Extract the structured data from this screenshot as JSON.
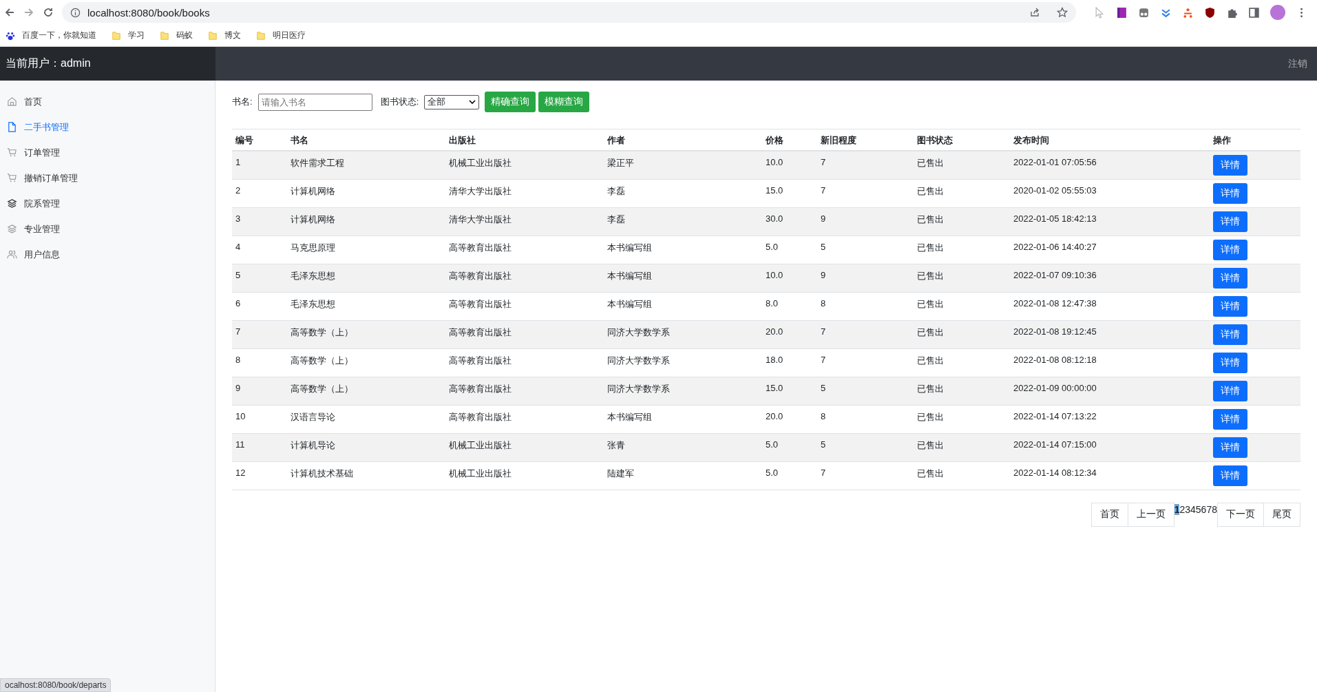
{
  "browser": {
    "url": "localhost:8080/book/books",
    "bookmarks": [
      {
        "label": "百度一下，你就知道",
        "kind": "site"
      },
      {
        "label": "学习",
        "kind": "folder"
      },
      {
        "label": "码蚁",
        "kind": "folder"
      },
      {
        "label": "博文",
        "kind": "folder"
      },
      {
        "label": "明日医疗",
        "kind": "folder"
      }
    ]
  },
  "header": {
    "user": "当前用户：admin",
    "logout": "注销"
  },
  "sidebar": {
    "items": [
      {
        "label": "首页",
        "kind": "home",
        "selected": false
      },
      {
        "label": "二手书管理",
        "kind": "file",
        "selected": true
      },
      {
        "label": "订单管理",
        "kind": "cart",
        "selected": false
      },
      {
        "label": "撤销订单管理",
        "kind": "cart",
        "selected": false
      },
      {
        "label": "院系管理",
        "kind": "stack",
        "selected": false
      },
      {
        "label": "专业管理",
        "kind": "layers",
        "selected": false
      },
      {
        "label": "用户信息",
        "kind": "users",
        "selected": false
      }
    ]
  },
  "search": {
    "name_label": "书名:",
    "placeholder": "请输入书名",
    "status_label": "图书状态:",
    "status_value": "全部",
    "buttons": [
      "精确查询",
      "模糊查询"
    ]
  },
  "table": {
    "columns": [
      "编号",
      "书名",
      "出版社",
      "作者",
      "价格",
      "新旧程度",
      "图书状态",
      "发布时间",
      "操作"
    ],
    "rows": [
      [
        "1",
        "软件需求工程",
        "机械工业出版社",
        "梁正平",
        "10.0",
        "7",
        "已售出",
        "2022-01-01 07:05:56",
        "详情"
      ],
      [
        "2",
        "计算机网络",
        "清华大学出版社",
        "李磊",
        "15.0",
        "7",
        "已售出",
        "2020-01-02 05:55:03",
        "详情"
      ],
      [
        "3",
        "计算机网络",
        "清华大学出版社",
        "李磊",
        "30.0",
        "9",
        "已售出",
        "2022-01-05 18:42:13",
        "详情"
      ],
      [
        "4",
        "马克思原理",
        "高等教育出版社",
        "本书编写组",
        "5.0",
        "5",
        "已售出",
        "2022-01-06 14:40:27",
        "详情"
      ],
      [
        "5",
        "毛泽东思想",
        "高等教育出版社",
        "本书编写组",
        "10.0",
        "9",
        "已售出",
        "2022-01-07 09:10:36",
        "详情"
      ],
      [
        "6",
        "毛泽东思想",
        "高等教育出版社",
        "本书编写组",
        "8.0",
        "8",
        "已售出",
        "2022-01-08 12:47:38",
        "详情"
      ],
      [
        "7",
        "高等数学（上）",
        "高等教育出版社",
        "同济大学数学系",
        "20.0",
        "7",
        "已售出",
        "2022-01-08 19:12:45",
        "详情"
      ],
      [
        "8",
        "高等数学（上）",
        "高等教育出版社",
        "同济大学数学系",
        "18.0",
        "7",
        "已售出",
        "2022-01-08 08:12:18",
        "详情"
      ],
      [
        "9",
        "高等数学（上）",
        "高等教育出版社",
        "同济大学数学系",
        "15.0",
        "5",
        "已售出",
        "2022-01-09 00:00:00",
        "详情"
      ],
      [
        "10",
        "汉语言导论",
        "高等教育出版社",
        "本书编写组",
        "20.0",
        "8",
        "已售出",
        "2022-01-14 07:13:22",
        "详情"
      ],
      [
        "11",
        "计算机导论",
        "机械工业出版社",
        "张青",
        "5.0",
        "5",
        "已售出",
        "2022-01-14 07:15:00",
        "详情"
      ],
      [
        "12",
        "计算机技术基础",
        "机械工业出版社",
        "陆建军",
        "5.0",
        "7",
        "已售出",
        "2022-01-14 08:12:34",
        "详情"
      ]
    ]
  },
  "pagination": {
    "first": "首页",
    "prev": "上一页",
    "pages": [
      {
        "label": "1",
        "selected": true
      },
      {
        "label": "2",
        "selected": false
      },
      {
        "label": "3",
        "selected": false
      },
      {
        "label": "4",
        "selected": false
      },
      {
        "label": "5",
        "selected": false
      },
      {
        "label": "6",
        "selected": false
      },
      {
        "label": "7",
        "selected": false
      },
      {
        "label": "8",
        "selected": false
      }
    ],
    "next": "下一页",
    "last": "尾页"
  },
  "status_bar": "ocalhost:8080/book/departs"
}
